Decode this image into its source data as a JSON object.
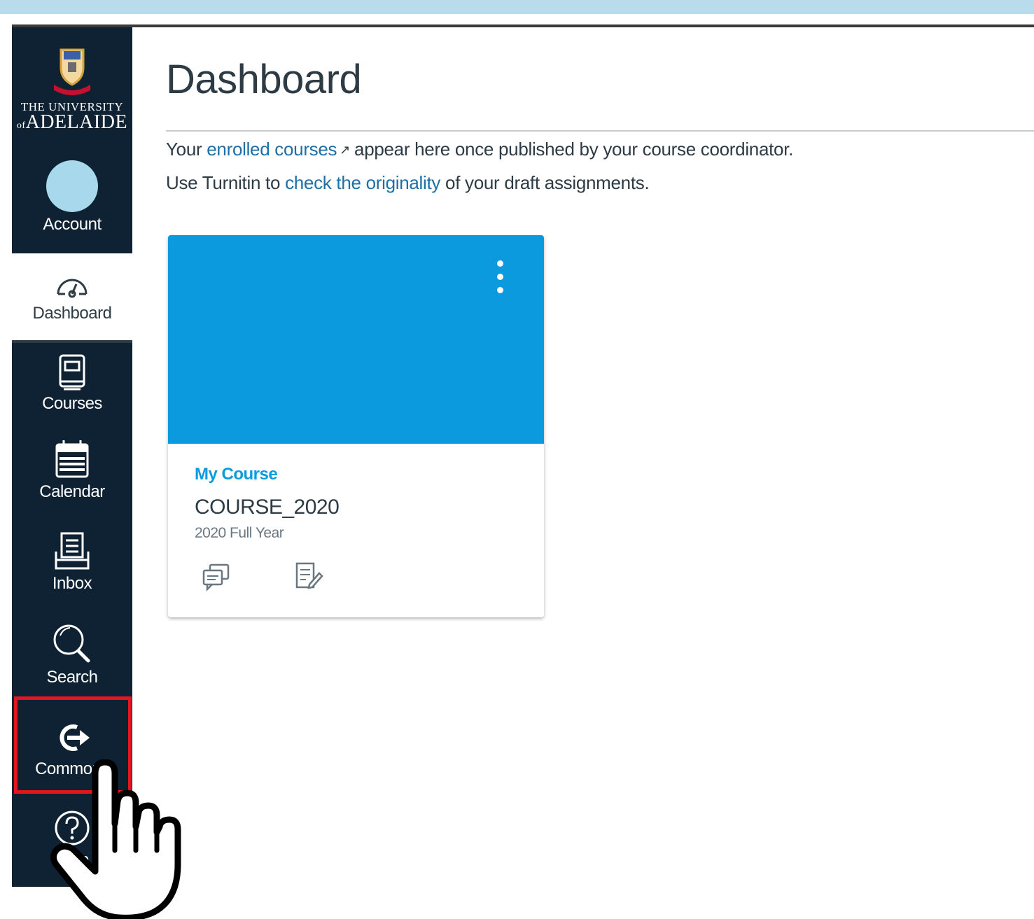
{
  "nav": {
    "logo_line1": "THE UNIVERSITY",
    "logo_line2": "ADELAIDE",
    "logo_prefix": "of",
    "account": "Account",
    "dashboard": "Dashboard",
    "courses": "Courses",
    "calendar": "Calendar",
    "inbox": "Inbox",
    "search": "Search",
    "commons": "Commons",
    "help": "Help"
  },
  "main": {
    "title": "Dashboard",
    "intro1_before": "Your ",
    "intro1_link": "enrolled courses",
    "intro1_after": "appear here once published by your course coordinator.",
    "intro2_before": "Use Turnitin to ",
    "intro2_link": "check the originality",
    "intro2_after": " of your draft assignments."
  },
  "card": {
    "name": "My Course",
    "code": "COURSE_2020",
    "term": "2020 Full Year",
    "hero_color": "#0b9ade"
  },
  "icons": {
    "ext_link": "↗"
  },
  "colors": {
    "nav_bg": "#0f2233",
    "highlight": "#e4151f",
    "link": "#1d6fa5"
  }
}
